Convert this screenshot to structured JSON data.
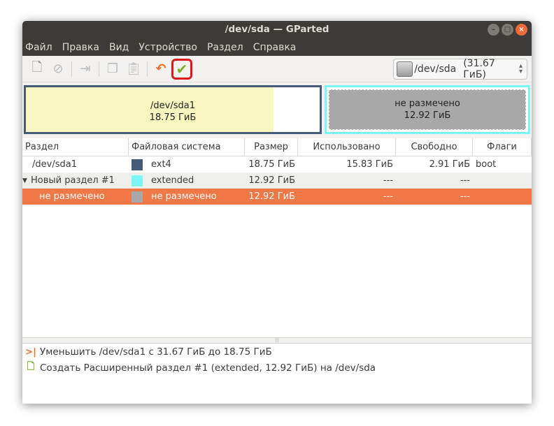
{
  "window": {
    "title": "/dev/sda — GParted"
  },
  "menu": [
    "Файл",
    "Правка",
    "Вид",
    "Устройство",
    "Раздел",
    "Справка"
  ],
  "device_selector": {
    "device": "/dev/sda",
    "size": "(31.67 ГиБ)"
  },
  "graph": {
    "partitions": [
      {
        "name": "/dev/sda1",
        "size": "18.75 ГиБ",
        "used_fraction": 0.844
      },
      {
        "name": "не размечено",
        "size": "12.92 ГиБ"
      }
    ]
  },
  "table": {
    "headers": [
      "Раздел",
      "Файловая система",
      "Размер",
      "Использовано",
      "Свободно",
      "Флаги"
    ],
    "rows": [
      {
        "partition": "/dev/sda1",
        "fs": "ext4",
        "fs_color": "#445a76",
        "size": "18.75 ГиБ",
        "used": "15.83 ГиБ",
        "free": "2.91 ГиБ",
        "flags": "boot"
      },
      {
        "partition": "Новый раздел #1",
        "fs": "extended",
        "fs_color": "#7cf5f5",
        "size": "12.92 ГиБ",
        "used": "---",
        "free": "---",
        "flags": ""
      },
      {
        "partition": "не размечено",
        "fs": "не размечено",
        "fs_color": "#a8a8a8",
        "size": "12.92 ГиБ",
        "used": "---",
        "free": "---",
        "flags": ""
      }
    ]
  },
  "operations": [
    "Уменьшить /dev/sda1 с 31.67 ГиБ до 18.75 ГиБ",
    "Создать Расширенный раздел #1 (extended, 12.92 ГиБ) на /dev/sda"
  ]
}
